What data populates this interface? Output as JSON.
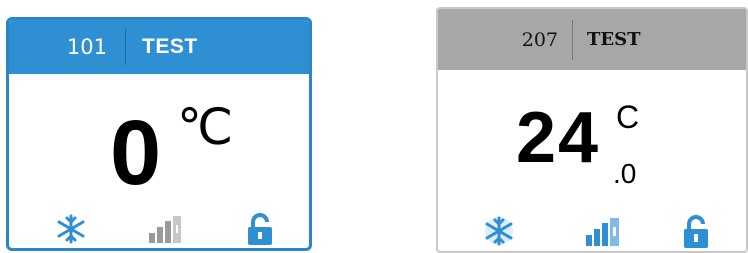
{
  "panels": [
    {
      "room": "101",
      "name": "TEST",
      "temperature": "0",
      "unit": "℃",
      "decimal": "",
      "header_color": "#2e8fd3",
      "border_color": "#2a86c8",
      "icons": [
        "snowflake-icon",
        "signal-bars-icon",
        "unlock-icon"
      ]
    },
    {
      "room": "207",
      "name": "TEST",
      "temperature": "24",
      "unit": "C",
      "decimal": ".0",
      "header_color": "#a7a7a7",
      "border_color": "#c9c9c9",
      "icons": [
        "snowflake-icon",
        "signal-bars-icon",
        "unlock-icon"
      ]
    }
  ],
  "colors": {
    "icon_blue": "#2e8fd3",
    "icon_gray": "#9a9a9a"
  }
}
